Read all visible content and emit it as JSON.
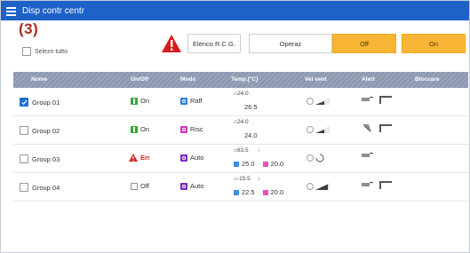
{
  "titlebar": {
    "title": "Disp contr centr"
  },
  "callout": "(3)",
  "select_all": {
    "label": "Selezn tutto"
  },
  "toolbar": {
    "rcg_label": "Elenco R.C.G.",
    "operaz_label": "Operaz",
    "off_label": "Off",
    "on_label": "On"
  },
  "columns": [
    "Nome",
    "On/Off",
    "Modo",
    "Temp.[°C]",
    "Vel vent",
    "Alert",
    "Bloccare"
  ],
  "rows": [
    {
      "checked": true,
      "name": "Group 01",
      "onoff": "On",
      "onoff_state": "on",
      "mode": "Raff",
      "mode_kind": "cool",
      "room_temp": "24.0",
      "set_main": "26.5",
      "set_heat": "",
      "arrow": "",
      "fan": "3",
      "alert_icons": [
        "plug",
        "pen"
      ]
    },
    {
      "checked": false,
      "name": "Group 02",
      "onoff": "On",
      "onoff_state": "on",
      "mode": "Risc",
      "mode_kind": "heat",
      "room_temp": "24.0",
      "set_main": "24.0",
      "set_heat": "",
      "arrow": "",
      "fan": "3",
      "alert_icons": [
        "vane",
        "pen"
      ]
    },
    {
      "checked": false,
      "name": "Group 03",
      "onoff": "Err",
      "onoff_state": "err",
      "mode": "Auto",
      "mode_kind": "auto",
      "room_temp": "63.5",
      "set_main": "25.0",
      "set_heat": "20.0",
      "arrow": "↑",
      "fan": "auto",
      "alert_icons": [
        "plug"
      ]
    },
    {
      "checked": false,
      "name": "Group 04",
      "onoff": "Off",
      "onoff_state": "off",
      "mode": "Auto",
      "mode_kind": "auto",
      "room_temp": "-15.5",
      "set_main": "22.5",
      "set_heat": "20.0",
      "arrow": "↓",
      "fan": "4",
      "alert_icons": [
        "plug",
        "pen"
      ]
    }
  ],
  "colors": {
    "titlebar": "#1e62c8",
    "orange_button": "#f8b434",
    "header": "#8d9bb4",
    "error": "#d62020",
    "on_green": "#37a637"
  }
}
